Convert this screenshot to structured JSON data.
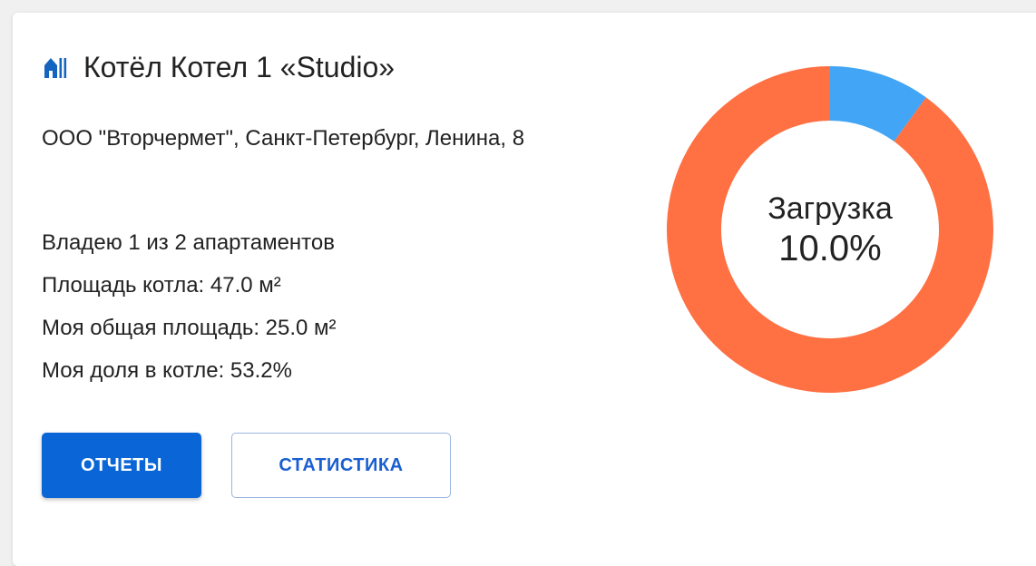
{
  "card": {
    "title": "Котёл Котел 1 «Studio»",
    "title_icon": "building-icon",
    "address": "ООО \"Вторчермет\", Санкт-Петербург, Ленина, 8",
    "stats": [
      "Владею 1 из 2 апартаментов",
      "Площадь котла: 47.0 м²",
      "Моя общая площадь: 25.0 м²",
      "Моя доля в котле: 53.2%"
    ],
    "buttons": {
      "reports": "ОТЧЕТЫ",
      "statistics": "СТАТИСТИКА"
    }
  },
  "chart_data": {
    "type": "pie",
    "caption": "Загрузка",
    "value_label": "10.0%",
    "slices": [
      {
        "value": 10.0,
        "color": "#42a5f5"
      },
      {
        "value": 90.0,
        "color": "#ff7043"
      }
    ]
  },
  "colors": {
    "primary": "#0a66d6",
    "load": "#42a5f5",
    "free": "#ff7043"
  }
}
